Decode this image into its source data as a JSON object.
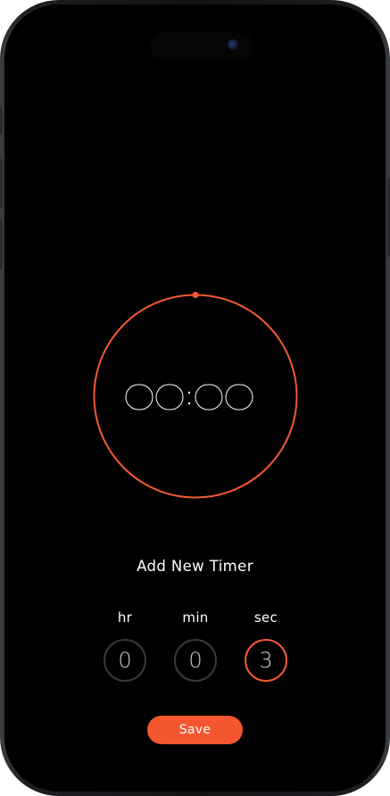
{
  "timer": {
    "display": "00:00",
    "digits": [
      "0",
      "0",
      "0",
      "0"
    ],
    "separator": ":",
    "progress": 0
  },
  "form": {
    "title": "Add New Timer",
    "units": [
      {
        "label": "hr",
        "value": "0",
        "selected": false
      },
      {
        "label": "min",
        "value": "0",
        "selected": false
      },
      {
        "label": "sec",
        "value": "3",
        "selected": true
      }
    ],
    "save_label": "Save"
  },
  "colors": {
    "accent": "#f4562f",
    "background": "#000000",
    "text": "#ffffff",
    "inactive_ring": "#3a3a3a"
  }
}
